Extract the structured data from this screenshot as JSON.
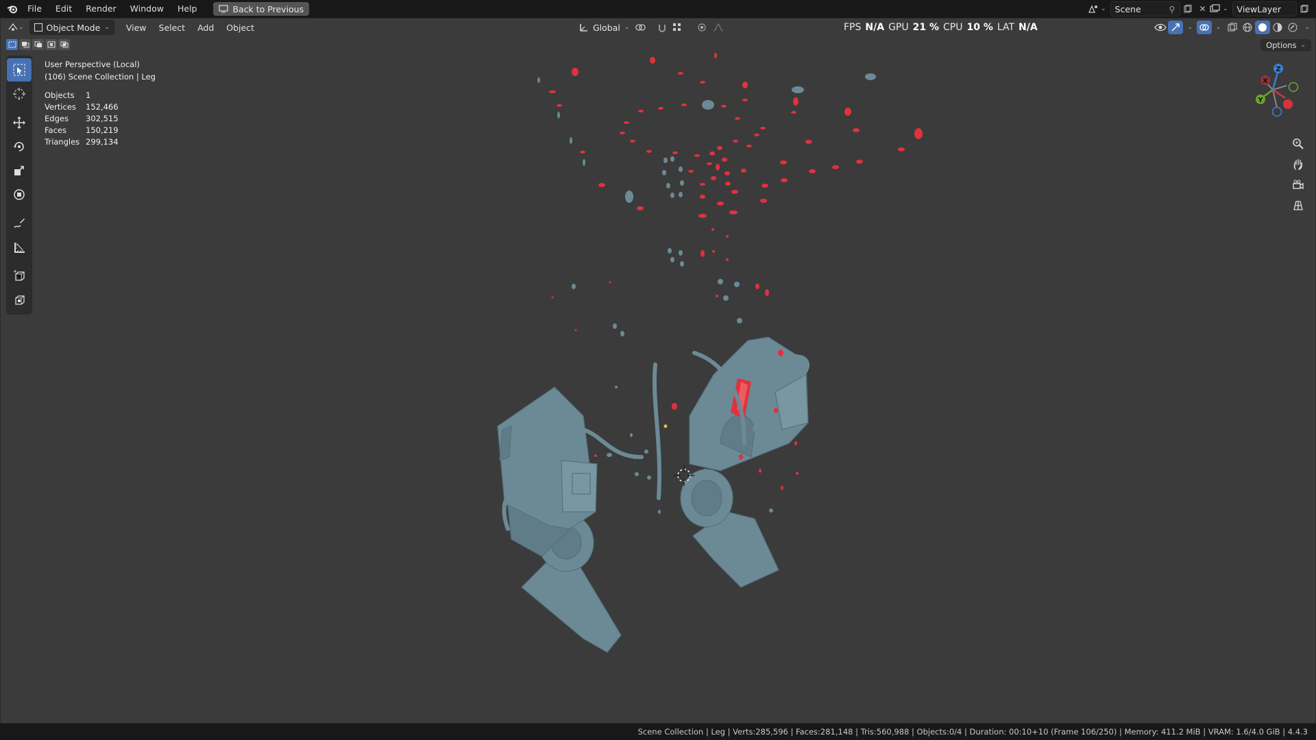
{
  "topbar": {
    "menus": [
      "File",
      "Edit",
      "Render",
      "Window",
      "Help"
    ],
    "back_label": "Back to Previous",
    "scene": "Scene",
    "view_layer": "ViewLayer"
  },
  "viewport_header": {
    "mode": "Object Mode",
    "menus": [
      "View",
      "Select",
      "Add",
      "Object"
    ],
    "orientation": "Global",
    "perf": {
      "fps_label": "FPS",
      "fps": "N/A",
      "gpu_label": "GPU",
      "gpu": "21 %",
      "cpu_label": "CPU",
      "cpu": "10 %",
      "lat_label": "LAT",
      "lat": "N/A"
    },
    "options_label": "Options"
  },
  "overlay": {
    "view_name": "User Perspective (Local)",
    "collection": "(106) Scene Collection | Leg",
    "stats": [
      {
        "label": "Objects",
        "value": "1"
      },
      {
        "label": "Vertices",
        "value": "152,466"
      },
      {
        "label": "Edges",
        "value": "302,515"
      },
      {
        "label": "Faces",
        "value": "150,219"
      },
      {
        "label": "Triangles",
        "value": "299,134"
      }
    ]
  },
  "gizmo": {
    "x": "X",
    "y": "Y",
    "z": "Z"
  },
  "statusbar": {
    "text": "Scene Collection | Leg | Verts:285,596 | Faces:281,148 | Tris:560,988 | Objects:0/4 | Duration: 00:10+10 (Frame 106/250) | Memory: 411.2 MiB | VRAM: 1.6/4.0 GiB | 4.4.3"
  },
  "colors": {
    "accent": "#4772b3",
    "viewport_bg": "#3b3b3b",
    "mesh": "#6b8a96",
    "debris_red": "#e0323e"
  }
}
